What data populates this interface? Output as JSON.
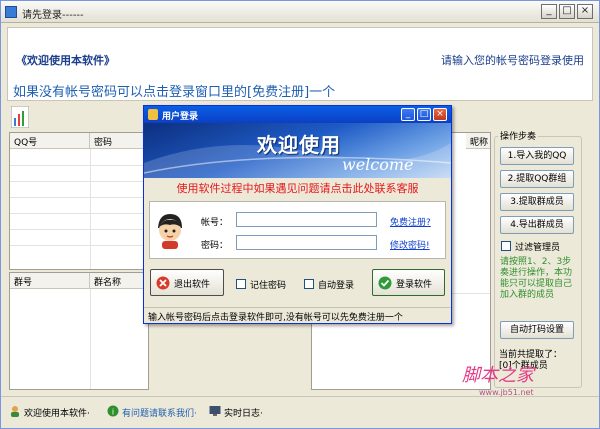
{
  "window": {
    "title": "请先登录------"
  },
  "header": {
    "welcome": "《欢迎使用本软件》",
    "prompt": "请输入您的帐号密码登录使用",
    "tip": "如果没有帐号密码可以点击登录窗口里的[免费注册]一个"
  },
  "qq_grid": {
    "columns": [
      "QQ号",
      "密码"
    ]
  },
  "group_grid": {
    "columns": [
      "群号",
      "群名称"
    ]
  },
  "member_grid": {
    "columns": [
      "昵称"
    ]
  },
  "ops": {
    "legend": "操作步奏",
    "buttons": [
      "1.导入我的QQ",
      "2.提取QQ群组",
      "3.提取群成员",
      "4.导出群成员"
    ],
    "filter_admin": "过滤管理员",
    "note": "请按照1、2、3步奏进行操作，本功能只可以提取自己加入群的成员",
    "auto_code": "自动打码设置",
    "extracted_label": "当前共提取了：",
    "extracted_count": "0",
    "extracted_unit": "个群成员"
  },
  "dialog": {
    "title": "用户登录",
    "banner_main": "欢迎使用",
    "banner_sub": "welcome",
    "warning": "使用软件过程中如果遇见问题请点击此处联系客服",
    "account_label": "帐号：",
    "password_label": "密码：",
    "register_link": "免费注册?",
    "change_password_link": "修改密码!",
    "exit_button": "退出软件",
    "remember_password": "记住密码",
    "auto_login": "自动登录",
    "login_button": "登录软件",
    "status": "输入帐号密码后点击登录软件即可,没有帐号可以先免费注册一个"
  },
  "statusbar": {
    "welcome": "欢迎使用本软件·",
    "help": "有问题请联系我们·",
    "log": "实时日志·"
  },
  "watermark": {
    "text": "脚本之家",
    "url": "www.jb51.net"
  },
  "colors": {
    "accent": "#1E5FB0",
    "warning": "#E8161B",
    "note": "#2F8F2F",
    "dialog_title": "#0A5FE6"
  }
}
